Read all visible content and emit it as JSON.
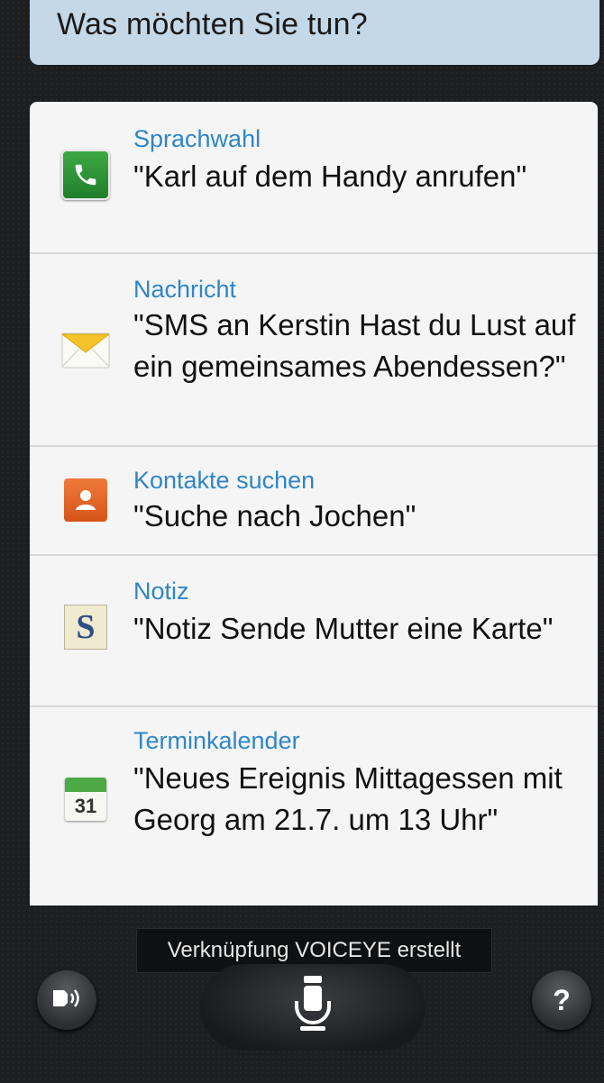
{
  "prompt": {
    "text": "Was möchten Sie tun?"
  },
  "commands": [
    {
      "category": "Sprachwahl",
      "example": "\"Karl auf dem Handy anrufen\"",
      "icon": "phone-icon"
    },
    {
      "category": "Nachricht",
      "example": "\"SMS an Kerstin Hast du Lust auf ein gemeinsames Abendessen?\"",
      "icon": "message-envelope-icon"
    },
    {
      "category": "Kontakte suchen",
      "example": "\"Suche nach Jochen\"",
      "icon": "contacts-icon"
    },
    {
      "category": "Notiz",
      "example": "\"Notiz Sende Mutter eine Karte\"",
      "icon": "memo-icon"
    },
    {
      "category": "Terminkalender",
      "example": "\"Neues Ereignis Mittagessen mit Georg am 21.7. um 13 Uhr\"",
      "icon": "calendar-icon",
      "icon_text": "31"
    }
  ],
  "toast": {
    "text": "Verknüpfung VOICEYE erstellt"
  },
  "buttons": {
    "speaker": "speaker-icon",
    "mic": "microphone-icon",
    "help": "?"
  },
  "colors": {
    "accent": "#2f86c6",
    "prompt_bg": "#c4d8e8",
    "list_bg": "#f5f5f5",
    "screen_bg": "#1d1e20"
  }
}
